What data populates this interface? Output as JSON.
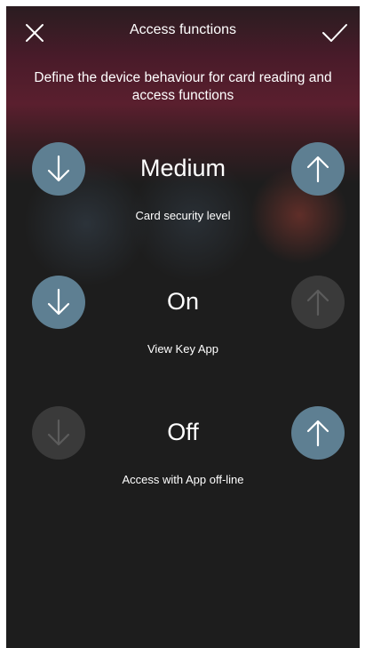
{
  "header": {
    "title": "Access functions",
    "close_icon": "close-icon",
    "confirm_icon": "checkmark-icon"
  },
  "intro": "Define the device behaviour for card reading and access functions",
  "settings": [
    {
      "value": "Medium",
      "label": "Card security level",
      "down_enabled": true,
      "up_enabled": true
    },
    {
      "value": "On",
      "label": "View Key App",
      "down_enabled": true,
      "up_enabled": false
    },
    {
      "value": "Off",
      "label": "Access with App off-line",
      "down_enabled": false,
      "up_enabled": true
    }
  ],
  "colors": {
    "button_active": "#5e7f92",
    "button_disabled": "#3a3a3a",
    "background": "#1d1d1d"
  }
}
